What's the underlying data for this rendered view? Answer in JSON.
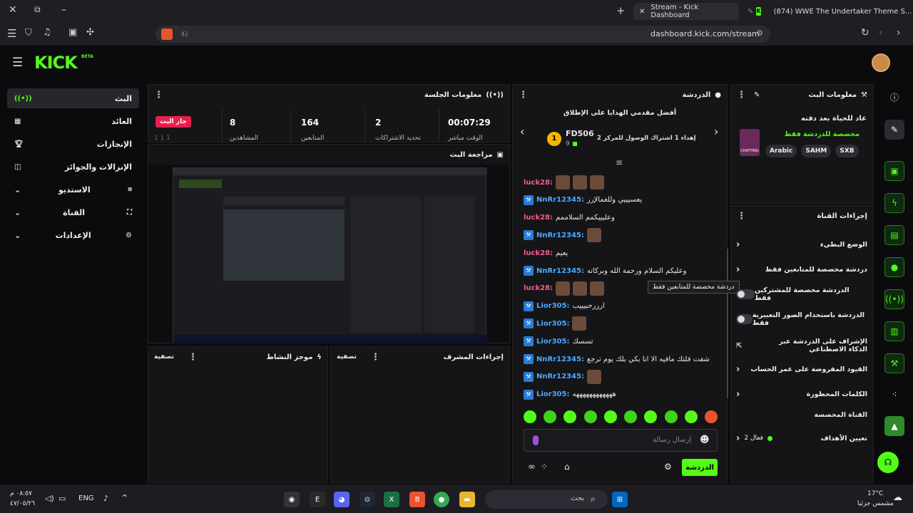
{
  "browser": {
    "tabs": [
      {
        "title": "Stream - Kick Dashboard"
      },
      {
        "title": "(874) WWE The Undertaker Theme S..."
      }
    ],
    "url": "dashboard.kick.com/stream"
  },
  "brand": {
    "logo": "KICK",
    "beta": "BETA"
  },
  "sidebar": {
    "items": [
      {
        "label": "البث",
        "icon": "broadcast-icon"
      },
      {
        "label": "العائد",
        "icon": "revenue-icon"
      },
      {
        "label": "الإنجازات",
        "icon": "trophy-icon"
      },
      {
        "label": "الإنزالات والجوائز",
        "icon": "gift-icon"
      },
      {
        "label": "الاستديو",
        "icon": "studio-icon"
      },
      {
        "label": "القناة",
        "icon": "channel-icon"
      },
      {
        "label": "الإعدادات",
        "icon": "gear-icon"
      }
    ]
  },
  "session": {
    "title": "معلومات الجلسة",
    "live_badge": "جار البث",
    "stats": [
      {
        "value": "8",
        "label": "المشاهدين"
      },
      {
        "value": "164",
        "label": "المتابعين"
      },
      {
        "value": "2",
        "label": "تحديد الاشتراكات"
      },
      {
        "value": "00:07:29",
        "label": "الوقت مباشر"
      }
    ],
    "truncated_left": "1 1 1"
  },
  "preview": {
    "title": "مراجعة البث"
  },
  "activity": {
    "title": "موجز النشاط",
    "filter": "تصفية"
  },
  "modactions": {
    "title": "إجراءات المشرف",
    "filter": "تصفية"
  },
  "chat": {
    "title": "الدردشة",
    "gifters_title": "أفضل مقدمي الهدايا على الإطلاق",
    "gifter_rank": "1",
    "gifter_name": "FD506",
    "gifter_count": "9",
    "gifter_info": "إهداء 1 اشتراك الوصول للمركز 2",
    "messages": [
      {
        "user": "luck28:",
        "color": "pink",
        "badge": false,
        "text": "",
        "emotes": 3
      },
      {
        "user": "NnRr12345:",
        "color": "blue",
        "badge": true,
        "text": "يعسيييي وللغمالإرر",
        "emotes": 0
      },
      {
        "user": "luck28:",
        "color": "pink",
        "badge": false,
        "text": "وعليييكمم السلاممم",
        "emotes": 0
      },
      {
        "user": "NnRr12345:",
        "color": "blue",
        "badge": true,
        "text": "",
        "emotes": 1
      },
      {
        "user": "luck28:",
        "color": "pink",
        "badge": false,
        "text": "يعيم",
        "emotes": 0
      },
      {
        "user": "NnRr12345:",
        "color": "blue",
        "badge": true,
        "text": "وعليكم السلام ورحمة الله وبركاته",
        "emotes": 0
      },
      {
        "user": "luck28:",
        "color": "pink",
        "badge": false,
        "text": "",
        "emotes": 3
      },
      {
        "user": "Lior305:",
        "color": "blue",
        "badge": true,
        "text": "ارررحبيييب",
        "emotes": 0
      },
      {
        "user": "Lior305:",
        "color": "blue",
        "badge": true,
        "text": "",
        "emotes": 1
      },
      {
        "user": "Lior305:",
        "color": "blue",
        "badge": true,
        "text": "تسسك",
        "emotes": 0
      },
      {
        "user": "NnRr12345:",
        "color": "blue",
        "badge": true,
        "text": "شفت فلتك مافيه الا انا بكي بلك يوم ترجع",
        "emotes": 0
      },
      {
        "user": "NnRr12345:",
        "color": "blue",
        "badge": true,
        "text": "",
        "emotes": 1
      },
      {
        "user": "Lior305:",
        "color": "blue",
        "badge": true,
        "text": "ههههههههههههه",
        "emotes": 0
      }
    ],
    "input_placeholder": "إرسال رسالة",
    "send_label": "الدردشة"
  },
  "streaminfo": {
    "title": "معلومات البث",
    "stream_title": "عاد للحياة بعد دفنه",
    "subtitle": "مخصصة للدردشة فقط",
    "thumb_caption": "CHATTING",
    "tags": [
      "Arabic",
      "SAHM",
      "SXB"
    ]
  },
  "channelactions": {
    "title": "إجراءات القناة",
    "tooltip": "دردشة مخصصة للمتابعين فقط",
    "rows": [
      {
        "label": "الوضع البطيء",
        "control": "chevron"
      },
      {
        "label": "دردشة مخصصة للمتابعين فقط",
        "control": "chevron"
      },
      {
        "label": "الدردشة مخصصة للمشتركين فقط",
        "control": "toggle"
      },
      {
        "label": "الدردشة باستخدام الصور التعبيرية فقط",
        "control": "toggle"
      },
      {
        "label": "الإشراف على الدردشة عبر الذكاء الاصطناعي",
        "control": "external"
      },
      {
        "label": "القيود المفروضة على عمر الحساب",
        "control": "chevron"
      },
      {
        "label": "الكلمات المحظورة",
        "control": "chevron"
      }
    ],
    "custom_title": "القناة المخصصة",
    "goal_label": "تعيين الأهداف",
    "goal_status": "فعال 2"
  },
  "taskbar": {
    "weather_temp": "17°C",
    "weather_desc": "مشمس جزئيا",
    "lang": "ENG",
    "time": "٠٨:٥٧ م",
    "date": "٤٧/٠٥/٢٦",
    "search_placeholder": "بحث"
  },
  "colors": {
    "accent": "#53fc18",
    "live": "#e91e4d",
    "bg": "#0b0b0d",
    "panel": "#151518"
  }
}
